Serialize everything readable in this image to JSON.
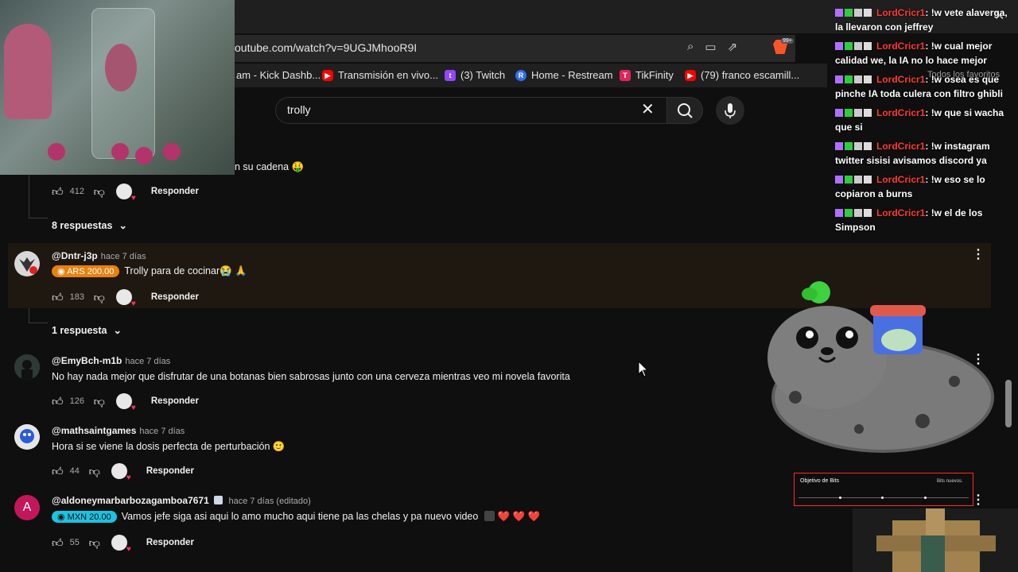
{
  "browser": {
    "url": "outube.com/watch?v=9UGJMhooR9I",
    "brave_badge": "99+",
    "bookmarks": [
      {
        "label": "am - Kick Dashb...",
        "icon": "kick-icon"
      },
      {
        "label": "Transmisión en vivo...",
        "icon": "youtube-icon"
      },
      {
        "label": "(3) Twitch",
        "icon": "twitch-icon"
      },
      {
        "label": "Home - Restream",
        "icon": "restream-icon"
      },
      {
        "label": "TikFinity",
        "icon": "tikfinity-icon"
      },
      {
        "label": "(79) franco escamill...",
        "icon": "youtube-icon"
      }
    ],
    "favorites_label": "Todos los favoritos"
  },
  "search": {
    "value": "trolly"
  },
  "comments": {
    "first_fragment": {
      "text": "n su cadena 🤑",
      "likes": "412",
      "reply": "Responder",
      "replies_toggle": "8 respuestas"
    },
    "items": [
      {
        "author": "@Dntr-j3p",
        "time": "hace 7 días",
        "chip": "ARS 200.00",
        "text": "Trolly para de cocinar😭 🙏",
        "likes": "183",
        "reply": "Responder",
        "replies_toggle": "1 respuesta"
      },
      {
        "author": "@EmyBch-m1b",
        "time": "hace 7 días",
        "text": "No hay nada mejor que disfrutar de una botanas bien sabrosas junto con una cerveza mientras veo mi novela favorita",
        "likes": "126",
        "reply": "Responder"
      },
      {
        "author": "@mathsaintgames",
        "time": "hace 7 días",
        "text": "Hora si se viene la dosis perfecta de perturbación 🙂",
        "likes": "44",
        "reply": "Responder"
      },
      {
        "author": "@aldoneymarbarbozagamboa7671",
        "time": "hace 7 días (editado)",
        "chip": "MXN 20.00",
        "text": "Vamos jefe siga asi aqui lo amo mucho aqui tiene pa las chelas y  pa nuevo video",
        "hearts": "❤️ ❤️ ❤️",
        "likes": "55",
        "reply": "Responder",
        "avatar_letter": "A"
      }
    ]
  },
  "chat": {
    "messages": [
      {
        "user": "LordCricr1",
        "text": ": !w vete alaverga, la llevaron con jeffrey"
      },
      {
        "user": "LordCricr1",
        "text": ": !w cual mejor calidad we, la IA no lo hace mejor"
      },
      {
        "user": "LordCricr1",
        "text": ": !w osea es que pinche IA toda culera con filtro ghibli"
      },
      {
        "user": "LordCricr1",
        "text": ": !w que si wacha que si"
      },
      {
        "user": "LordCricr1",
        "text": ": !w instagram twitter sisisi avisamos discord ya"
      },
      {
        "user": "LordCricr1",
        "text": ": !w eso se lo copiaron a burns"
      },
      {
        "user": "LordCricr1",
        "text": ": !w el de los Simpson"
      }
    ]
  },
  "bits_goal": {
    "title": "Objetivo de Bits",
    "subtitle": "Bits nuevos."
  },
  "colors": {
    "background": "#0f0f0f",
    "chat_user": "#ff3b30",
    "ars_chip": "#e8820c",
    "mxn_chip": "#1ec2e0",
    "highlight_row": "#1e1811"
  }
}
